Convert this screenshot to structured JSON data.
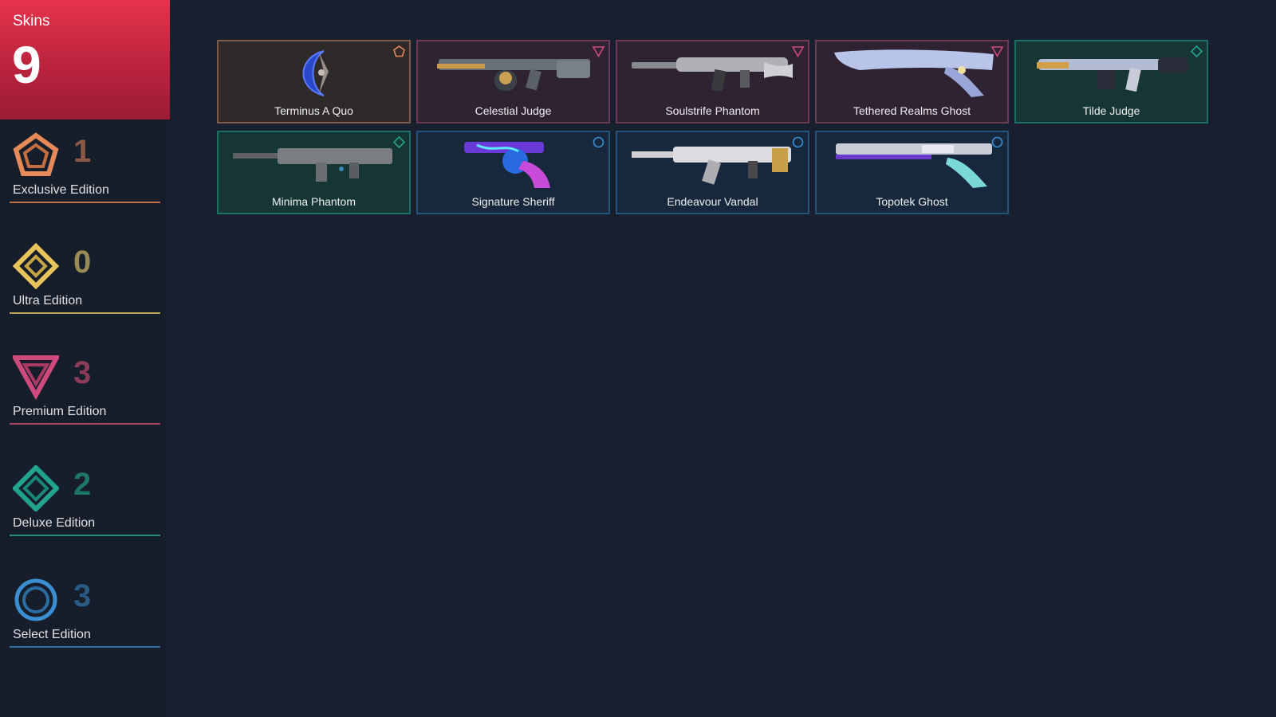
{
  "summary": {
    "label": "Skins",
    "count": "9"
  },
  "tiers": [
    {
      "name": "Exclusive Edition",
      "count": "1",
      "icon": "exclusive-edition-icon",
      "color": "#e58a58"
    },
    {
      "name": "Ultra Edition",
      "count": "0",
      "icon": "ultra-edition-icon",
      "color": "#e6c45a"
    },
    {
      "name": "Premium Edition",
      "count": "3",
      "icon": "premium-edition-icon",
      "color": "#cf4a7c"
    },
    {
      "name": "Deluxe Edition",
      "count": "2",
      "icon": "deluxe-edition-icon",
      "color": "#21a38c"
    },
    {
      "name": "Select Edition",
      "count": "3",
      "icon": "select-edition-icon",
      "color": "#3a8fd1"
    }
  ],
  "skins": [
    {
      "name": "Terminus A Quo",
      "tier": "exclusive",
      "art": "melee-blade-icon"
    },
    {
      "name": "Celestial Judge",
      "tier": "premium",
      "art": "shotgun-icon"
    },
    {
      "name": "Soulstrife Phantom",
      "tier": "premium",
      "art": "rifle-icon"
    },
    {
      "name": "Tethered Realms Ghost",
      "tier": "premium",
      "art": "pistol-icon"
    },
    {
      "name": "Tilde Judge",
      "tier": "deluxe",
      "art": "shotgun-icon"
    },
    {
      "name": "Minima Phantom",
      "tier": "deluxe",
      "art": "rifle-icon"
    },
    {
      "name": "Signature Sheriff",
      "tier": "select",
      "art": "revolver-icon"
    },
    {
      "name": "Endeavour Vandal",
      "tier": "select",
      "art": "rifle-icon"
    },
    {
      "name": "Topotek Ghost",
      "tier": "select",
      "art": "pistol-icon"
    }
  ]
}
